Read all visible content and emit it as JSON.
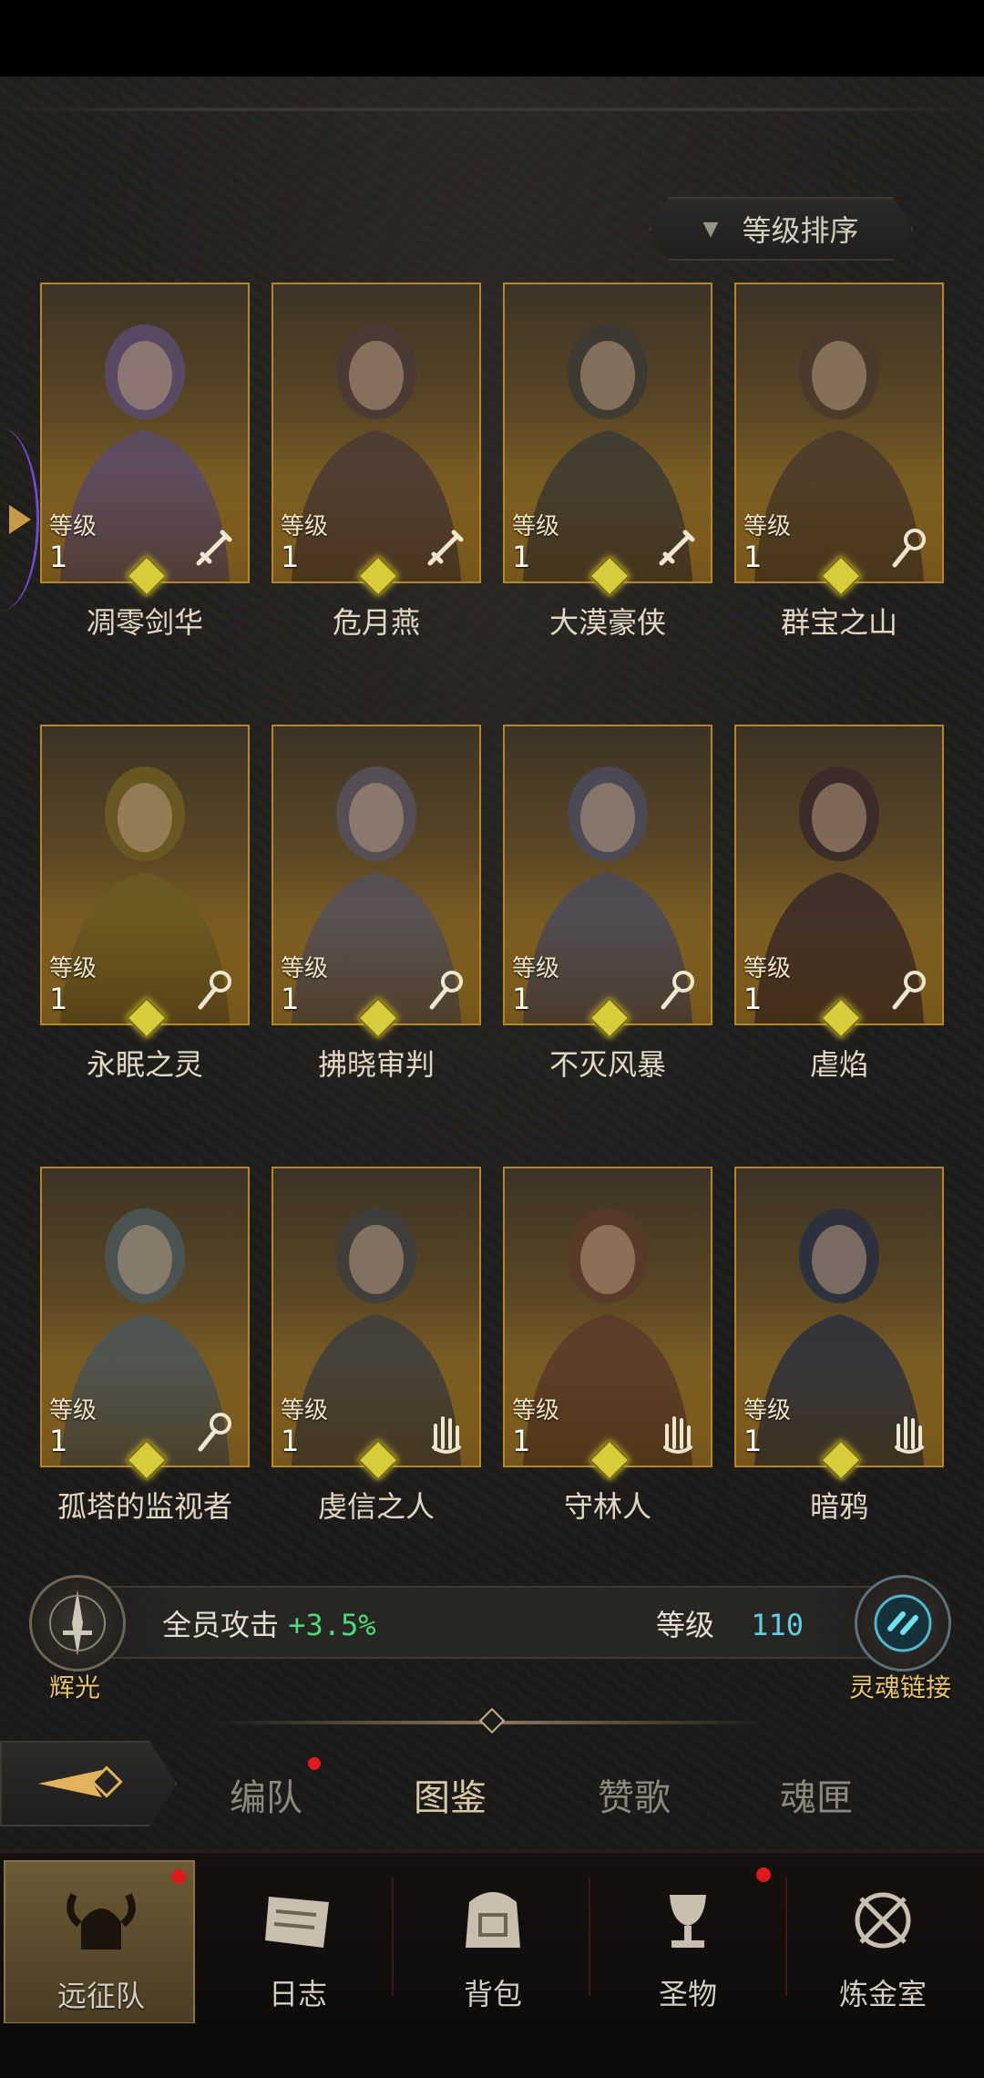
{
  "sort": {
    "label": "等级排序"
  },
  "level_label": "等级",
  "heroes": [
    {
      "name": "凋零剑华",
      "level": "1",
      "role": "sword-icon"
    },
    {
      "name": "危月燕",
      "level": "1",
      "role": "sword-icon"
    },
    {
      "name": "大漠豪侠",
      "level": "1",
      "role": "sword-icon"
    },
    {
      "name": "群宝之山",
      "level": "1",
      "role": "staff-icon"
    },
    {
      "name": "永眠之灵",
      "level": "1",
      "role": "staff-icon"
    },
    {
      "name": "拂晓审判",
      "level": "1",
      "role": "staff-icon"
    },
    {
      "name": "不灭风暴",
      "level": "1",
      "role": "staff-icon"
    },
    {
      "name": "虐焰",
      "level": "1",
      "role": "staff-icon"
    },
    {
      "name": "孤塔的监视者",
      "level": "1",
      "role": "staff-icon"
    },
    {
      "name": "虔信之人",
      "level": "1",
      "role": "hand-icon"
    },
    {
      "name": "守林人",
      "level": "1",
      "role": "hand-icon"
    },
    {
      "name": "暗鸦",
      "level": "1",
      "role": "hand-icon"
    }
  ],
  "bonus": {
    "emblem_label": "辉光",
    "text": "全员攻击",
    "value": "+3.5%",
    "level_label": "等级",
    "level_value": "110",
    "link_label": "灵魂链接"
  },
  "subtabs": [
    {
      "label": "编队",
      "badge": true
    },
    {
      "label": "图鉴",
      "active": true
    },
    {
      "label": "赞歌"
    },
    {
      "label": "魂匣"
    }
  ],
  "nav": [
    {
      "label": "远征队",
      "active": true,
      "badge": true
    },
    {
      "label": "日志"
    },
    {
      "label": "背包"
    },
    {
      "label": "圣物",
      "badge": true
    },
    {
      "label": "炼金室"
    }
  ],
  "colors": {
    "background": "#1b1a18",
    "card_gold": "#b4862c",
    "bonus_green": "#4ddc7a",
    "level_cyan": "#5fd0e6",
    "badge_red": "#e01a1a"
  }
}
